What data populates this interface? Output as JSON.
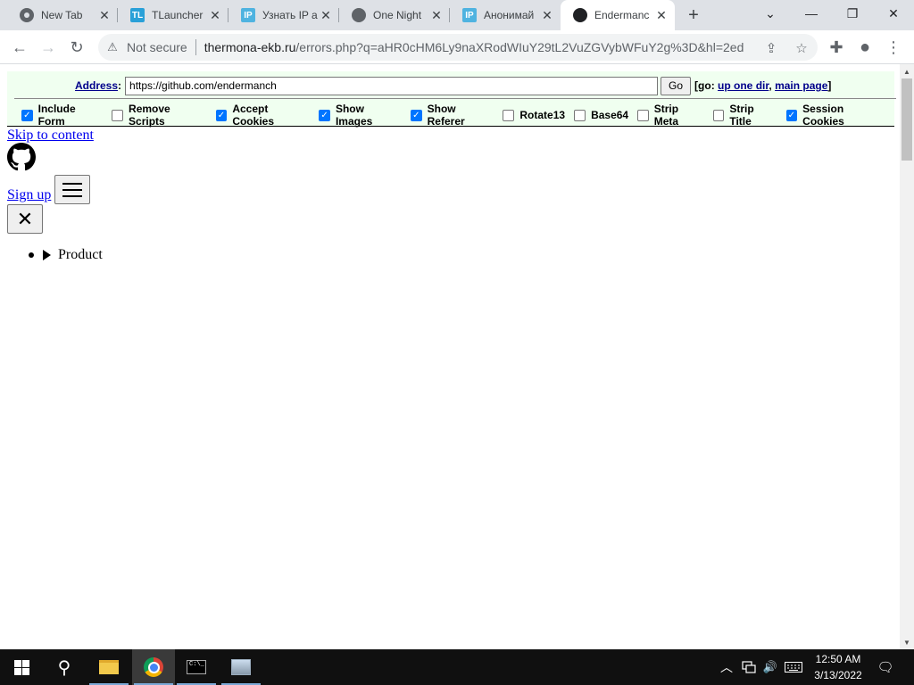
{
  "browser": {
    "tabs": [
      {
        "title": "New Tab",
        "icon": "chrome-icon",
        "favicon_text": "",
        "active": false
      },
      {
        "title": "TLauncher",
        "icon": "tlauncher-icon",
        "favicon_text": "TL",
        "active": false
      },
      {
        "title": "Узнать IP а",
        "icon": "ip-icon",
        "favicon_text": "IP",
        "active": false
      },
      {
        "title": "One Night",
        "icon": "globe-icon",
        "favicon_text": "",
        "active": false
      },
      {
        "title": "Анонимай",
        "icon": "ip-icon",
        "favicon_text": "IP",
        "active": false
      },
      {
        "title": "Endermanc",
        "icon": "github-icon",
        "favicon_text": "",
        "active": true
      }
    ],
    "new_tab_symbol": "+",
    "window_controls": {
      "minimize": "—",
      "maximize": "❐",
      "close": "✕",
      "tab_search": "⌄"
    },
    "nav": {
      "back": "←",
      "forward": "→",
      "reload": "↻"
    },
    "omnibox": {
      "security_icon": "⚠",
      "security_text": "Not secure",
      "host": "thermona-ekb.ru",
      "path": "/errors.php?q=aHR0cHM6Ly9naXRodWIuY29tL2VuZGVybWFuY2g%3D&hl=2ed"
    },
    "toolbar_icons": {
      "share": "⇪",
      "bookmark": "☆",
      "extensions": "✚",
      "profile": "●",
      "menu": "⋮"
    }
  },
  "proxy": {
    "address_label": "Address",
    "address_value": "https://github.com/endermanch",
    "go_label": "Go",
    "go_prefix": "[go:",
    "up_one_dir": "up one dir",
    "comma": ",",
    "main_page": "main page",
    "go_suffix": "]",
    "options": [
      {
        "label": "Include Form",
        "checked": true
      },
      {
        "label": "Remove Scripts",
        "checked": false
      },
      {
        "label": "Accept Cookies",
        "checked": true
      },
      {
        "label": "Show Images",
        "checked": true
      },
      {
        "label": "Show Referer",
        "checked": true
      },
      {
        "label": "Rotate13",
        "checked": false
      },
      {
        "label": "Base64",
        "checked": false
      },
      {
        "label": "Strip Meta",
        "checked": false
      },
      {
        "label": "Strip Title",
        "checked": false
      },
      {
        "label": "Session Cookies",
        "checked": true
      }
    ]
  },
  "content": {
    "skip_link": "Skip to content",
    "sign_up": "Sign up",
    "close_symbol": "✕",
    "product_label": "Product"
  },
  "taskbar": {
    "clock_time": "12:50 AM",
    "clock_date": "3/13/2022",
    "search_symbol": "⚲",
    "tray_up": "︿",
    "tray_volume": "🔊",
    "notification": "🗨"
  },
  "colors": {
    "proxy_bg": "#f0fff0",
    "link": "#0000ee",
    "proxy_link": "#00008b",
    "checkbox_on": "#0075ff",
    "taskbar": "#101010"
  }
}
